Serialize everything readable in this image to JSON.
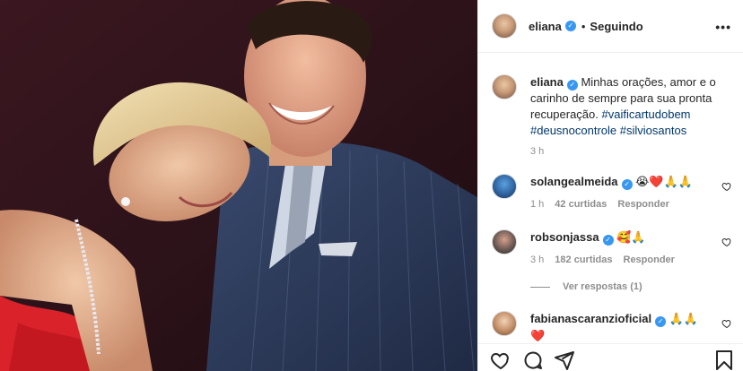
{
  "post": {
    "username": "eliana",
    "follow_state": "Seguindo",
    "verified_mark": "✓",
    "separator": "•"
  },
  "caption": {
    "username": "eliana",
    "text": " Minhas orações, amor e o carinho de sempre para sua pronta recuperação. ",
    "hashtags": [
      "#vaificartudobem",
      "#deusnocontrole",
      "#silviosantos"
    ],
    "time": "3 h"
  },
  "comments": [
    {
      "username": "solangealmeida",
      "text": "😭❤️🙏🙏",
      "time": "1 h",
      "likes": "42 curtidas",
      "reply": "Responder"
    },
    {
      "username": "robsonjassa",
      "text": "🥰🙏",
      "time": "3 h",
      "likes": "182 curtidas",
      "reply": "Responder"
    },
    {
      "username": "fabianascaranzioficial",
      "text": "🙏🙏",
      "text2": "❤️"
    }
  ],
  "view_replies": "Ver respostas (1)",
  "icons": {
    "more": "more-options-icon",
    "like": "heart-icon",
    "comment": "comment-icon",
    "share": "share-icon",
    "save": "bookmark-icon"
  },
  "colors": {
    "link": "#00376b",
    "verified": "#3897f0",
    "muted": "#8e8e8e"
  }
}
